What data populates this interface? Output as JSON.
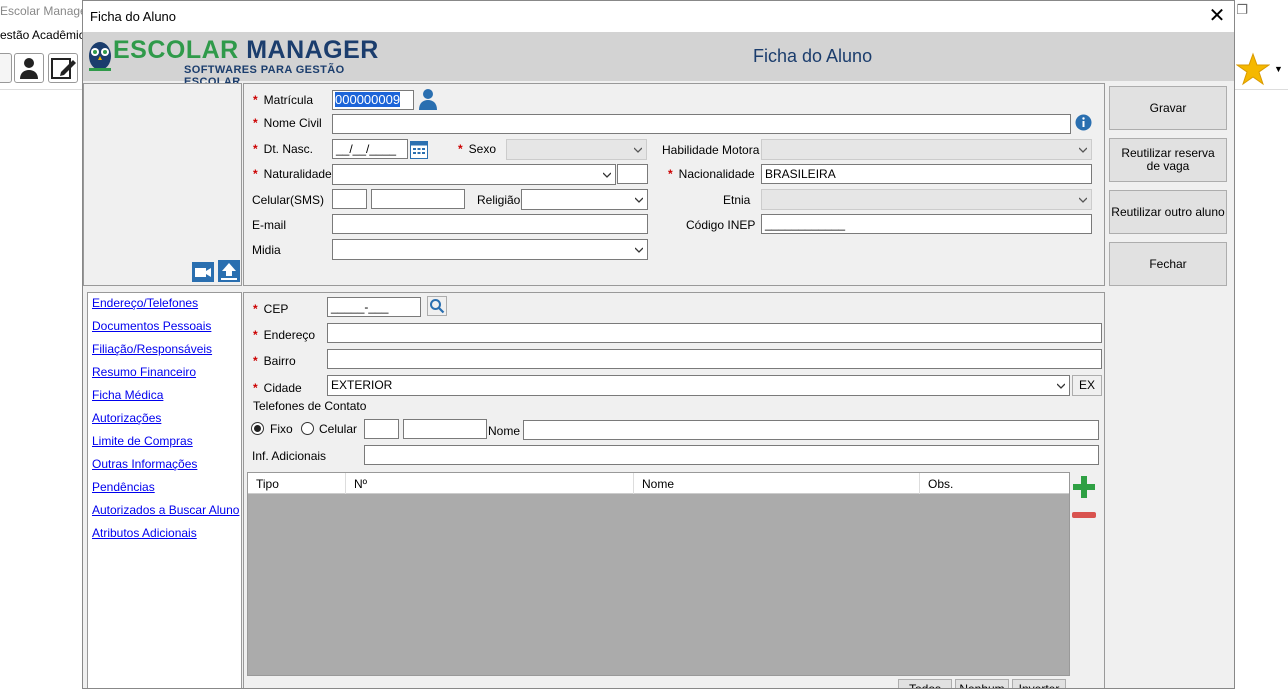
{
  "background_app": {
    "title": "Escolar Manage",
    "menu": "estão Acadêmic",
    "restore_icon": "restore-window-icon",
    "favorites_icon": "star-icon"
  },
  "dialog": {
    "title": "Ficha do Aluno",
    "close_label": "✕",
    "header_title": "Ficha do Aluno",
    "logo": {
      "escolar": "ESCOLAR",
      "manager": "MANAGER",
      "tagline": "SOFTWARES PARA GESTÃO ESCOLAR"
    }
  },
  "form": {
    "matricula_label": "Matrícula",
    "matricula_value": "000000009",
    "nome_civil_label": "Nome Civil",
    "nome_civil_value": "",
    "dt_nasc_label": "Dt. Nasc.",
    "dt_nasc_value": "__/__/____",
    "sexo_label": "Sexo",
    "sexo_value": "",
    "habilidade_label": "Habilidade Motora",
    "habilidade_value": "",
    "naturalidade_label": "Naturalidade",
    "naturalidade_value": "",
    "naturalidade_uf": "",
    "nacionalidade_label": "Nacionalidade",
    "nacionalidade_value": "BRASILEIRA",
    "celular_label": "Celular(SMS)",
    "celular_ddd": "",
    "celular_num": "",
    "religiao_label": "Religião",
    "religiao_value": "",
    "etnia_label": "Etnia",
    "etnia_value": "",
    "email_label": "E-mail",
    "email_value": "",
    "inep_label": "Código INEP",
    "inep_value": "____________",
    "midia_label": "Midia",
    "midia_value": ""
  },
  "actions": {
    "gravar": "Gravar",
    "reutilizar_reserva": "Reutilizar reserva de vaga",
    "reutilizar_aluno": "Reutilizar outro aluno",
    "fechar": "Fechar"
  },
  "nav": {
    "items": [
      "Endereço/Telefones",
      "Documentos Pessoais",
      "Filiação/Responsáveis",
      "Resumo Financeiro",
      "Ficha Médica",
      "Autorizações",
      "Limite de Compras",
      "Outras Informações",
      "Pendências",
      "Autorizados a Buscar Aluno",
      "Atributos Adicionais"
    ]
  },
  "address": {
    "cep_label": "CEP",
    "cep_value": "_____-___",
    "endereco_label": "Endereço",
    "endereco_value": "",
    "bairro_label": "Bairro",
    "bairro_value": "",
    "cidade_label": "Cidade",
    "cidade_value": "EXTERIOR",
    "uf_button": "EX",
    "telefones_group": "Telefones de Contato",
    "fixo_label": "Fixo",
    "celular_label": "Celular",
    "phone_type_selected": "Fixo",
    "tel_ddd": "",
    "tel_num": "",
    "nome_label": "Nome",
    "nome_value": "",
    "inf_label": "Inf. Adicionais",
    "inf_value": "",
    "grid_columns": [
      "Tipo",
      "Nº",
      "Nome",
      "Obs."
    ],
    "grid_rows": [],
    "todos": "Todos",
    "nenhum": "Nenhum",
    "inverter": "Inverter"
  },
  "colors": {
    "brand_green": "#2f9a4a",
    "brand_navy": "#1b3d6d",
    "icon_blue": "#2a6fb0",
    "required_red": "#cc0000"
  }
}
